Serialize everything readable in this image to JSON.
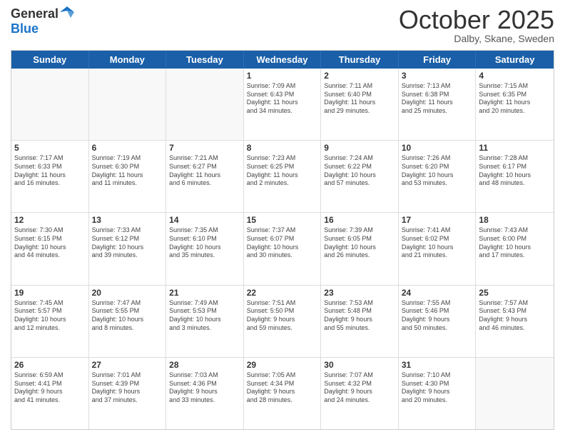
{
  "header": {
    "logo": {
      "general": "General",
      "blue": "Blue"
    },
    "title": "October 2025",
    "location": "Dalby, Skane, Sweden"
  },
  "calendar": {
    "weekdays": [
      "Sunday",
      "Monday",
      "Tuesday",
      "Wednesday",
      "Thursday",
      "Friday",
      "Saturday"
    ],
    "rows": [
      [
        {
          "day": "",
          "text": "",
          "empty": true
        },
        {
          "day": "",
          "text": "",
          "empty": true
        },
        {
          "day": "",
          "text": "",
          "empty": true
        },
        {
          "day": "1",
          "text": "Sunrise: 7:09 AM\nSunset: 6:43 PM\nDaylight: 11 hours\nand 34 minutes."
        },
        {
          "day": "2",
          "text": "Sunrise: 7:11 AM\nSunset: 6:40 PM\nDaylight: 11 hours\nand 29 minutes."
        },
        {
          "day": "3",
          "text": "Sunrise: 7:13 AM\nSunset: 6:38 PM\nDaylight: 11 hours\nand 25 minutes."
        },
        {
          "day": "4",
          "text": "Sunrise: 7:15 AM\nSunset: 6:35 PM\nDaylight: 11 hours\nand 20 minutes."
        }
      ],
      [
        {
          "day": "5",
          "text": "Sunrise: 7:17 AM\nSunset: 6:33 PM\nDaylight: 11 hours\nand 16 minutes."
        },
        {
          "day": "6",
          "text": "Sunrise: 7:19 AM\nSunset: 6:30 PM\nDaylight: 11 hours\nand 11 minutes."
        },
        {
          "day": "7",
          "text": "Sunrise: 7:21 AM\nSunset: 6:27 PM\nDaylight: 11 hours\nand 6 minutes."
        },
        {
          "day": "8",
          "text": "Sunrise: 7:23 AM\nSunset: 6:25 PM\nDaylight: 11 hours\nand 2 minutes."
        },
        {
          "day": "9",
          "text": "Sunrise: 7:24 AM\nSunset: 6:22 PM\nDaylight: 10 hours\nand 57 minutes."
        },
        {
          "day": "10",
          "text": "Sunrise: 7:26 AM\nSunset: 6:20 PM\nDaylight: 10 hours\nand 53 minutes."
        },
        {
          "day": "11",
          "text": "Sunrise: 7:28 AM\nSunset: 6:17 PM\nDaylight: 10 hours\nand 48 minutes."
        }
      ],
      [
        {
          "day": "12",
          "text": "Sunrise: 7:30 AM\nSunset: 6:15 PM\nDaylight: 10 hours\nand 44 minutes."
        },
        {
          "day": "13",
          "text": "Sunrise: 7:33 AM\nSunset: 6:12 PM\nDaylight: 10 hours\nand 39 minutes."
        },
        {
          "day": "14",
          "text": "Sunrise: 7:35 AM\nSunset: 6:10 PM\nDaylight: 10 hours\nand 35 minutes."
        },
        {
          "day": "15",
          "text": "Sunrise: 7:37 AM\nSunset: 6:07 PM\nDaylight: 10 hours\nand 30 minutes."
        },
        {
          "day": "16",
          "text": "Sunrise: 7:39 AM\nSunset: 6:05 PM\nDaylight: 10 hours\nand 26 minutes."
        },
        {
          "day": "17",
          "text": "Sunrise: 7:41 AM\nSunset: 6:02 PM\nDaylight: 10 hours\nand 21 minutes."
        },
        {
          "day": "18",
          "text": "Sunrise: 7:43 AM\nSunset: 6:00 PM\nDaylight: 10 hours\nand 17 minutes."
        }
      ],
      [
        {
          "day": "19",
          "text": "Sunrise: 7:45 AM\nSunset: 5:57 PM\nDaylight: 10 hours\nand 12 minutes."
        },
        {
          "day": "20",
          "text": "Sunrise: 7:47 AM\nSunset: 5:55 PM\nDaylight: 10 hours\nand 8 minutes."
        },
        {
          "day": "21",
          "text": "Sunrise: 7:49 AM\nSunset: 5:53 PM\nDaylight: 10 hours\nand 3 minutes."
        },
        {
          "day": "22",
          "text": "Sunrise: 7:51 AM\nSunset: 5:50 PM\nDaylight: 9 hours\nand 59 minutes."
        },
        {
          "day": "23",
          "text": "Sunrise: 7:53 AM\nSunset: 5:48 PM\nDaylight: 9 hours\nand 55 minutes."
        },
        {
          "day": "24",
          "text": "Sunrise: 7:55 AM\nSunset: 5:46 PM\nDaylight: 9 hours\nand 50 minutes."
        },
        {
          "day": "25",
          "text": "Sunrise: 7:57 AM\nSunset: 5:43 PM\nDaylight: 9 hours\nand 46 minutes."
        }
      ],
      [
        {
          "day": "26",
          "text": "Sunrise: 6:59 AM\nSunset: 4:41 PM\nDaylight: 9 hours\nand 41 minutes."
        },
        {
          "day": "27",
          "text": "Sunrise: 7:01 AM\nSunset: 4:39 PM\nDaylight: 9 hours\nand 37 minutes."
        },
        {
          "day": "28",
          "text": "Sunrise: 7:03 AM\nSunset: 4:36 PM\nDaylight: 9 hours\nand 33 minutes."
        },
        {
          "day": "29",
          "text": "Sunrise: 7:05 AM\nSunset: 4:34 PM\nDaylight: 9 hours\nand 28 minutes."
        },
        {
          "day": "30",
          "text": "Sunrise: 7:07 AM\nSunset: 4:32 PM\nDaylight: 9 hours\nand 24 minutes."
        },
        {
          "day": "31",
          "text": "Sunrise: 7:10 AM\nSunset: 4:30 PM\nDaylight: 9 hours\nand 20 minutes."
        },
        {
          "day": "",
          "text": "",
          "empty": true
        }
      ]
    ]
  }
}
